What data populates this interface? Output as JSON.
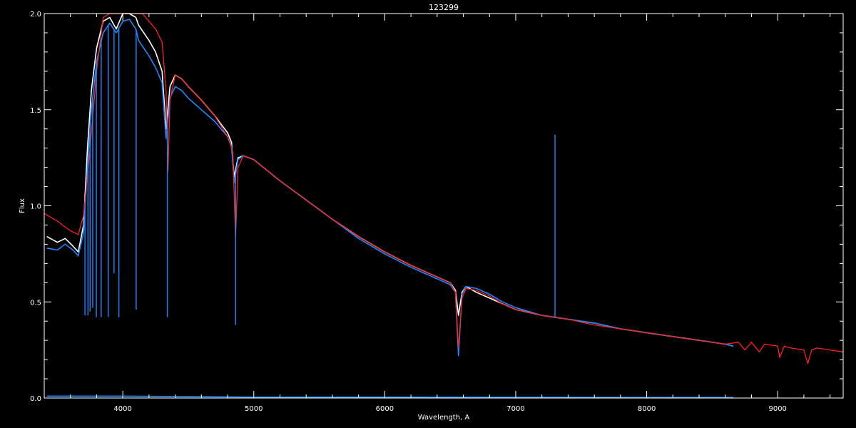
{
  "chart_data": {
    "type": "line",
    "title": "123299",
    "xlabel": "Wavelength, A",
    "ylabel": "Flux",
    "xlim": [
      3400,
      9500
    ],
    "ylim": [
      0,
      2.0
    ],
    "x_ticks": [
      4000,
      5000,
      6000,
      7000,
      8000,
      9000
    ],
    "x_tick_labels": [
      "4000",
      "5000",
      "6000",
      "7000",
      "8000",
      "9000"
    ],
    "y_ticks": [
      0.0,
      0.5,
      1.0,
      1.5,
      2.0
    ],
    "y_tick_labels": [
      "0.0",
      "0.5",
      "1.0",
      "1.5",
      "2.0"
    ],
    "grid": false,
    "background_color": "#000000",
    "axis_color": "#ffffff",
    "series": [
      {
        "color": "#ffffff",
        "x": [
          3420,
          3500,
          3560,
          3620,
          3660,
          3700,
          3730,
          3760,
          3800,
          3850,
          3900,
          3950,
          4000,
          4050,
          4100,
          4120,
          4200,
          4250,
          4300,
          4330,
          4360,
          4400,
          4450,
          4500,
          4600,
          4700,
          4800,
          4830,
          4850,
          4880,
          4920,
          5000,
          5200,
          5400,
          5600,
          5800,
          6000,
          6200,
          6400,
          6500,
          6540,
          6563,
          6590,
          6620,
          6700,
          6800,
          6900,
          7000,
          7200,
          7300,
          7400,
          7600,
          7800,
          8000,
          8200,
          8400,
          8600,
          8660
        ],
        "y": [
          0.84,
          0.81,
          0.83,
          0.79,
          0.76,
          0.9,
          1.3,
          1.6,
          1.82,
          1.96,
          1.98,
          1.92,
          2.0,
          2.0,
          1.98,
          1.94,
          1.86,
          1.8,
          1.7,
          1.4,
          1.62,
          1.68,
          1.66,
          1.62,
          1.55,
          1.47,
          1.38,
          1.33,
          1.15,
          1.25,
          1.26,
          1.24,
          1.13,
          1.03,
          0.93,
          0.84,
          0.76,
          0.69,
          0.63,
          0.6,
          0.56,
          0.43,
          0.55,
          0.58,
          0.55,
          0.52,
          0.49,
          0.46,
          0.43,
          0.42,
          0.41,
          0.39,
          0.36,
          0.34,
          0.32,
          0.3,
          0.28,
          0.27
        ]
      },
      {
        "color": "#1e88ff",
        "x": [
          3420,
          3500,
          3560,
          3620,
          3660,
          3700,
          3730,
          3760,
          3800,
          3850,
          3900,
          3950,
          4000,
          4050,
          4100,
          4120,
          4200,
          4250,
          4300,
          4330,
          4360,
          4400,
          4450,
          4500,
          4600,
          4700,
          4800,
          4830,
          4850,
          4880,
          4920,
          5000,
          5200,
          5400,
          5600,
          5800,
          6000,
          6200,
          6400,
          6500,
          6540,
          6563,
          6590,
          6620,
          6700,
          6800,
          6900,
          7000,
          7200,
          7300,
          7400,
          7600,
          7800,
          8000,
          8200,
          8400,
          8600,
          8660
        ],
        "y": [
          0.78,
          0.77,
          0.8,
          0.77,
          0.74,
          0.86,
          1.2,
          1.5,
          1.75,
          1.9,
          1.95,
          1.9,
          1.96,
          1.97,
          1.92,
          1.86,
          1.78,
          1.72,
          1.64,
          1.35,
          1.56,
          1.62,
          1.6,
          1.56,
          1.5,
          1.44,
          1.36,
          1.31,
          1.12,
          1.24,
          1.26,
          1.24,
          1.13,
          1.03,
          0.93,
          0.83,
          0.75,
          0.68,
          0.62,
          0.59,
          0.55,
          0.22,
          0.54,
          0.58,
          0.57,
          0.54,
          0.5,
          0.47,
          0.43,
          0.42,
          0.41,
          0.39,
          0.36,
          0.34,
          0.32,
          0.3,
          0.28,
          0.27
        ]
      },
      {
        "color": "#ff2020",
        "x": [
          3400,
          3500,
          3600,
          3660,
          3700,
          3750,
          3800,
          3850,
          3900,
          3950,
          4000,
          4050,
          4100,
          4150,
          4200,
          4250,
          4300,
          4330,
          4345,
          4360,
          4400,
          4450,
          4500,
          4600,
          4700,
          4800,
          4840,
          4861,
          4880,
          4920,
          5000,
          5200,
          5400,
          5600,
          5800,
          6000,
          6200,
          6400,
          6500,
          6540,
          6563,
          6590,
          6620,
          6700,
          6800,
          6900,
          7000,
          7200,
          7400,
          7600,
          7800,
          8000,
          8200,
          8400,
          8600,
          8700,
          8750,
          8800,
          8860,
          8900,
          9000,
          9015,
          9050,
          9100,
          9200,
          9230,
          9260,
          9300,
          9400,
          9500
        ],
        "y": [
          0.96,
          0.92,
          0.87,
          0.85,
          0.95,
          1.3,
          1.7,
          1.98,
          2.0,
          2.0,
          2.0,
          2.0,
          2.0,
          2.0,
          1.96,
          1.92,
          1.85,
          1.6,
          1.18,
          1.55,
          1.68,
          1.66,
          1.62,
          1.55,
          1.47,
          1.36,
          1.28,
          0.83,
          1.2,
          1.26,
          1.24,
          1.13,
          1.03,
          0.93,
          0.84,
          0.76,
          0.69,
          0.63,
          0.6,
          0.55,
          0.26,
          0.52,
          0.57,
          0.56,
          0.53,
          0.49,
          0.46,
          0.43,
          0.41,
          0.38,
          0.36,
          0.34,
          0.32,
          0.3,
          0.28,
          0.29,
          0.25,
          0.29,
          0.24,
          0.28,
          0.27,
          0.21,
          0.27,
          0.26,
          0.25,
          0.18,
          0.25,
          0.26,
          0.25,
          0.24
        ]
      },
      {
        "color": "#1e88ff",
        "x": [
          3420,
          4000,
          5000,
          6000,
          7000,
          8000,
          8660
        ],
        "y": [
          0.01,
          0.01,
          0.005,
          0.005,
          0.004,
          0.003,
          0.003
        ]
      }
    ],
    "absorption_lines": [
      {
        "x": 3711,
        "y": 0.43
      },
      {
        "x": 3734,
        "y": 0.43
      },
      {
        "x": 3750,
        "y": 0.45
      },
      {
        "x": 3770,
        "y": 0.47
      },
      {
        "x": 3798,
        "y": 0.42
      },
      {
        "x": 3835,
        "y": 0.42
      },
      {
        "x": 3889,
        "y": 0.42
      },
      {
        "x": 3933,
        "y": 0.65
      },
      {
        "x": 3970,
        "y": 0.42
      },
      {
        "x": 4102,
        "y": 0.46
      },
      {
        "x": 4340,
        "y": 0.42
      },
      {
        "x": 4861,
        "y": 0.38
      }
    ],
    "emission_lines": [
      {
        "x": 7300,
        "y": 1.37
      }
    ]
  }
}
